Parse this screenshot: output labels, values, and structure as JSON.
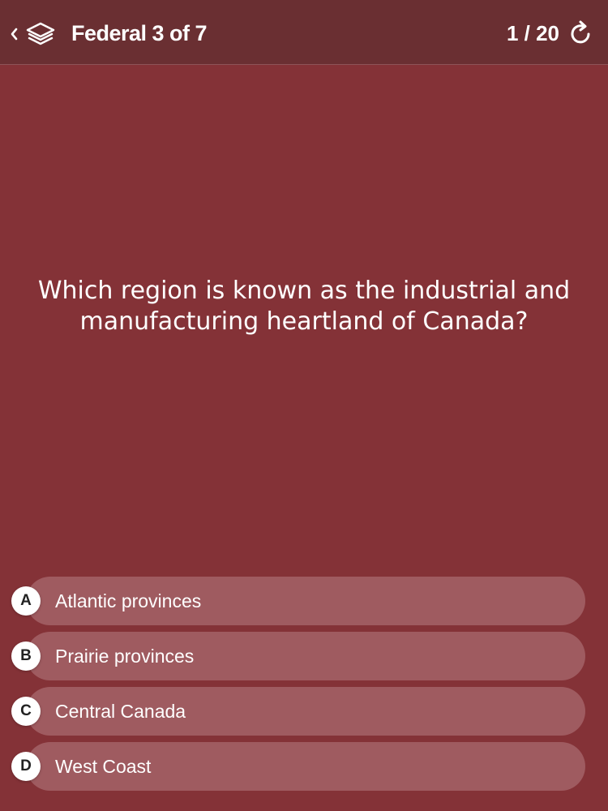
{
  "header": {
    "title": "Federal 3 of 7",
    "counter": "1 / 20",
    "back_icon": "chevron-left-icon",
    "set_icon": "layers-icon",
    "refresh_icon": "refresh-icon"
  },
  "question": {
    "text": "Which region is known as the industrial and manufacturing heartland of Canada?"
  },
  "answers": [
    {
      "letter": "A",
      "text": "Atlantic provinces"
    },
    {
      "letter": "B",
      "text": "Prairie provinces"
    },
    {
      "letter": "C",
      "text": "Central Canada"
    },
    {
      "letter": "D",
      "text": "West Coast"
    }
  ],
  "colors": {
    "background": "#843237",
    "header": "#6a2f32",
    "answer_pill": "#9f5b60",
    "badge": "#ffffff"
  }
}
